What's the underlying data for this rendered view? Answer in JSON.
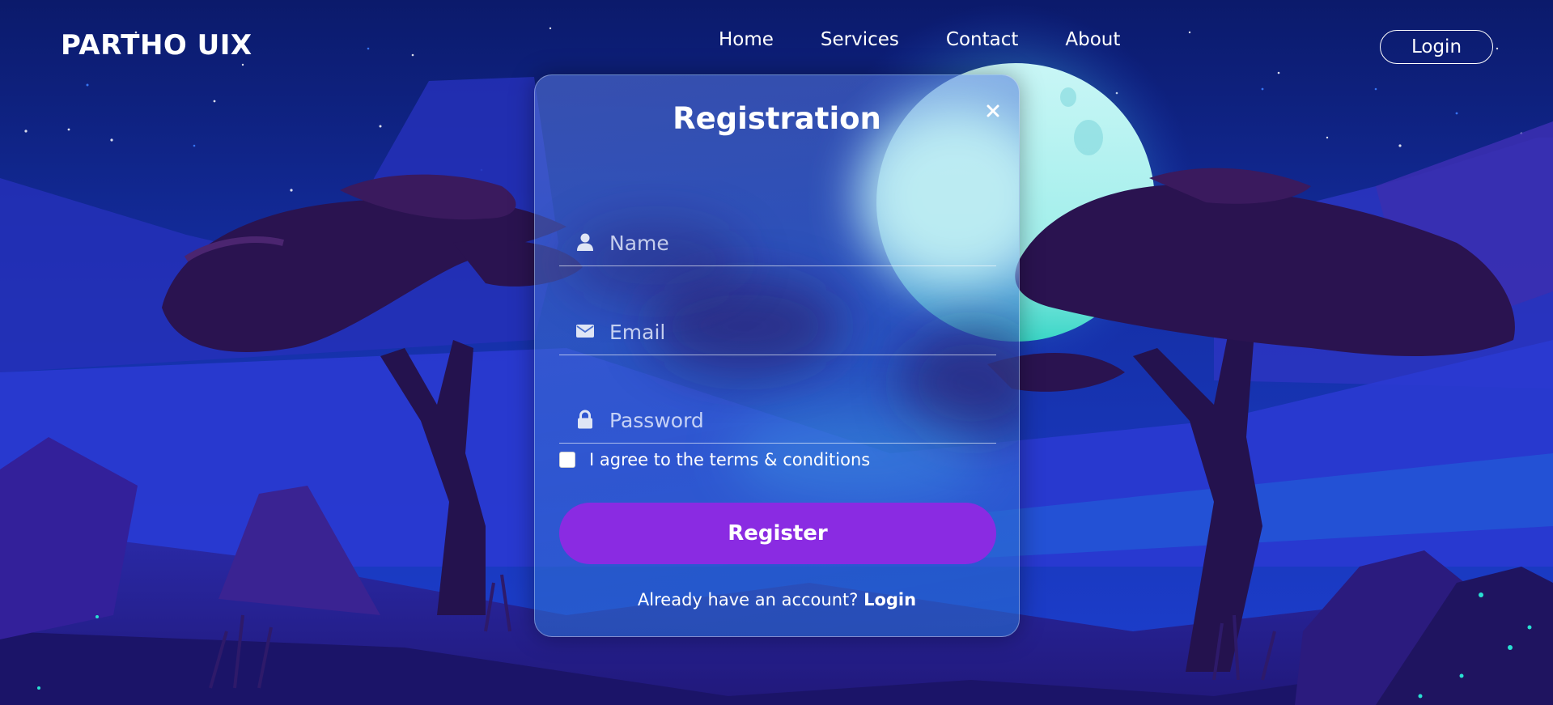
{
  "header": {
    "logo": "PARTHO UIX",
    "nav": [
      {
        "label": "Home"
      },
      {
        "label": "Services"
      },
      {
        "label": "Contact"
      },
      {
        "label": "About"
      }
    ],
    "login_button": "Login"
  },
  "modal": {
    "title": "Registration",
    "close_icon": "close-icon",
    "fields": {
      "name": {
        "placeholder": "Name",
        "icon": "user-icon"
      },
      "email": {
        "placeholder": "Email",
        "icon": "envelope-icon"
      },
      "password": {
        "placeholder": "Password",
        "icon": "lock-icon"
      }
    },
    "terms_label": "I agree to the terms & conditions",
    "register_button": "Register",
    "footer_prompt": "Already have an account? ",
    "footer_login": "Login"
  },
  "colors": {
    "accent": "#8a2be2",
    "sky": "#0e1a6e",
    "moon": "#bff3f5"
  }
}
